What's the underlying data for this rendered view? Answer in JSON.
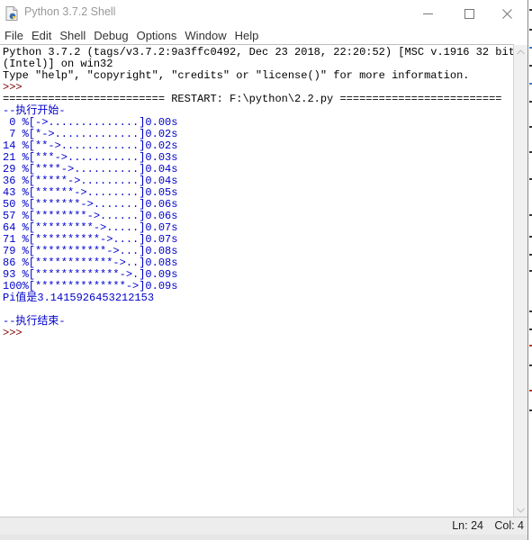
{
  "window": {
    "title": "Python 3.7.2 Shell",
    "controls": {
      "minimize": "—",
      "maximize": "☐",
      "close": "✕"
    }
  },
  "menubar": {
    "items": [
      {
        "label": "File"
      },
      {
        "label": "Edit"
      },
      {
        "label": "Shell"
      },
      {
        "label": "Debug"
      },
      {
        "label": "Options"
      },
      {
        "label": "Window"
      },
      {
        "label": "Help"
      }
    ]
  },
  "shell": {
    "lines": [
      {
        "type": "output",
        "text": "Python 3.7.2 (tags/v3.7.2:9a3ffc0492, Dec 23 2018, 22:20:52) [MSC v.1916 32 bit"
      },
      {
        "type": "output",
        "text": "(Intel)] on win32"
      },
      {
        "type": "output",
        "text": "Type \"help\", \"copyright\", \"credits\" or \"license()\" for more information."
      },
      {
        "type": "prompt",
        "text": ">>> "
      },
      {
        "type": "output",
        "text": "========================= RESTART: F:\\python\\2.2.py ========================="
      },
      {
        "type": "stdout",
        "text": "--执行开始-"
      },
      {
        "type": "stdout",
        "text": " 0 %[->..............]0.00s"
      },
      {
        "type": "stdout",
        "text": " 7 %[*->.............]0.02s"
      },
      {
        "type": "stdout",
        "text": "14 %[**->............]0.02s"
      },
      {
        "type": "stdout",
        "text": "21 %[***->...........]0.03s"
      },
      {
        "type": "stdout",
        "text": "29 %[****->..........]0.04s"
      },
      {
        "type": "stdout",
        "text": "36 %[*****->.........]0.04s"
      },
      {
        "type": "stdout",
        "text": "43 %[******->........]0.05s"
      },
      {
        "type": "stdout",
        "text": "50 %[*******->.......]0.06s"
      },
      {
        "type": "stdout",
        "text": "57 %[********->......]0.06s"
      },
      {
        "type": "stdout",
        "text": "64 %[*********->.....]0.07s"
      },
      {
        "type": "stdout",
        "text": "71 %[**********->....]0.07s"
      },
      {
        "type": "stdout",
        "text": "79 %[***********->...]0.08s"
      },
      {
        "type": "stdout",
        "text": "86 %[************->..]0.08s"
      },
      {
        "type": "stdout",
        "text": "93 %[*************->.]0.09s"
      },
      {
        "type": "stdout",
        "text": "100%[**************->]0.09s"
      },
      {
        "type": "stdout",
        "text": "Pi值是3.1415926453212153"
      },
      {
        "type": "stdout",
        "text": ""
      },
      {
        "type": "stdout",
        "text": "--执行结束-"
      },
      {
        "type": "prompt",
        "text": ">>> "
      }
    ]
  },
  "scrollbar": {
    "up_icon": "chevron-up",
    "down_icon": "chevron-down"
  },
  "statusbar": {
    "line": "Ln: 24",
    "col": "Col: 4"
  },
  "colors": {
    "output": "#000000",
    "prompt": "#800000",
    "stdout": "#0000cc"
  }
}
